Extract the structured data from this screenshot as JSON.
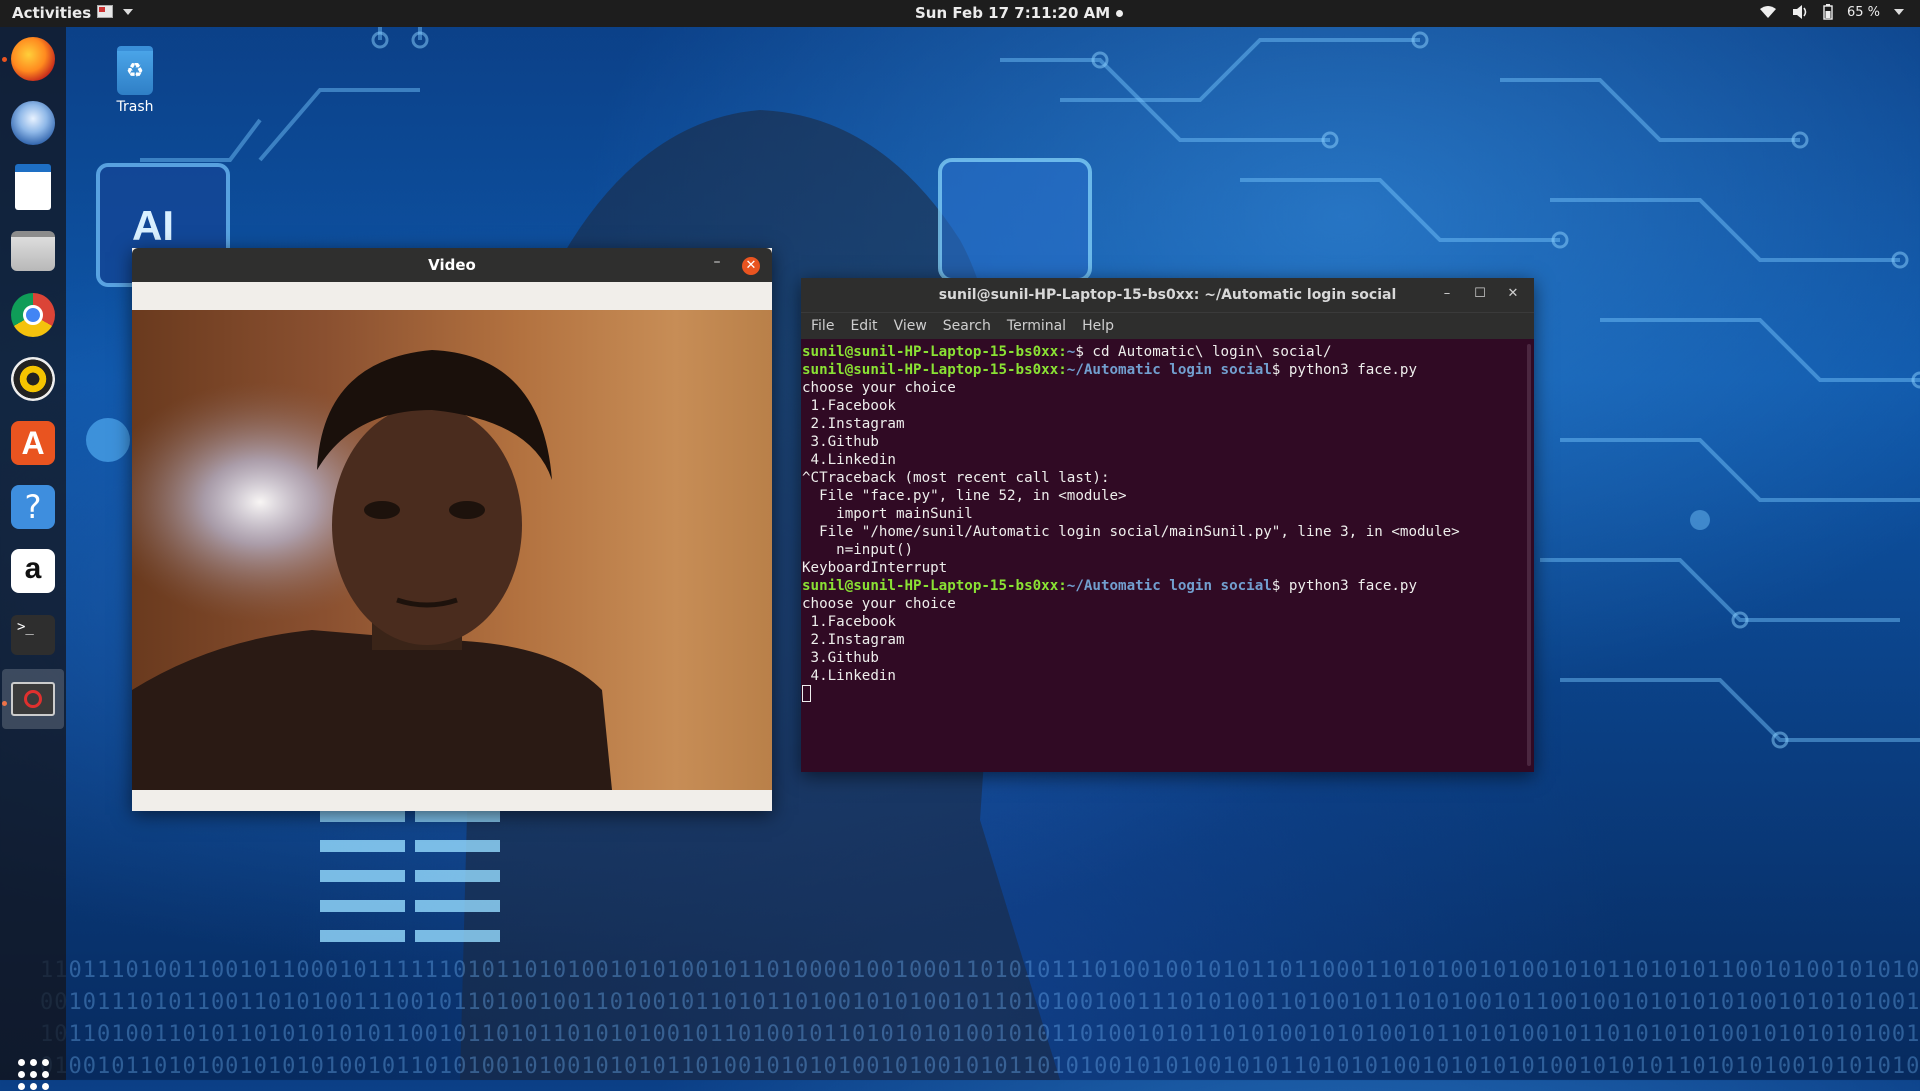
{
  "topbar": {
    "activities": "Activities",
    "clock": "Sun Feb 17   7:11:20 AM",
    "battery": "65 %",
    "icons": [
      "keyboard-flag-icon",
      "wifi-icon",
      "volume-icon",
      "battery-icon",
      "system-menu-chevron-icon"
    ]
  },
  "desktop": {
    "trash_label": "Trash"
  },
  "dock": {
    "items": [
      "Firefox",
      "Thunderbird",
      "LibreOffice Writer",
      "Files",
      "Chrome",
      "Rhythmbox",
      "Ubuntu Software",
      "Help",
      "Amazon",
      "Terminal",
      "Video"
    ]
  },
  "video_window": {
    "title": "Video",
    "minimize": "–",
    "close": "✕"
  },
  "terminal_window": {
    "title": "sunil@sunil-HP-Laptop-15-bs0xx: ~/Automatic login social",
    "menu": [
      "File",
      "Edit",
      "View",
      "Search",
      "Terminal",
      "Help"
    ],
    "lines": [
      {
        "user": "sunil@sunil-HP-Laptop-15-bs0xx",
        "path": "~",
        "cmd": "$ cd Automatic\\ login\\ social/"
      },
      {
        "user": "sunil@sunil-HP-Laptop-15-bs0xx",
        "path": "~/Automatic login social",
        "cmd": "$ python3 face.py"
      },
      {
        "text": "choose your choice"
      },
      {
        "text": " 1.Facebook"
      },
      {
        "text": " 2.Instagram"
      },
      {
        "text": " 3.Github"
      },
      {
        "text": " 4.Linkedin"
      },
      {
        "text": "^CTraceback (most recent call last):"
      },
      {
        "text": "  File \"face.py\", line 52, in <module>"
      },
      {
        "text": "    import mainSunil"
      },
      {
        "text": "  File \"/home/sunil/Automatic login social/mainSunil.py\", line 3, in <module>"
      },
      {
        "text": "    n=input()"
      },
      {
        "text": "KeyboardInterrupt"
      },
      {
        "user": "sunil@sunil-HP-Laptop-15-bs0xx",
        "path": "~/Automatic login social",
        "cmd": "$ python3 face.py"
      },
      {
        "text": "choose your choice"
      },
      {
        "text": " 1.Facebook"
      },
      {
        "text": " 2.Instagram"
      },
      {
        "text": " 3.Github"
      },
      {
        "text": " 4.Linkedin"
      }
    ]
  },
  "colors": {
    "accent": "#e95420",
    "terminal_bg": "#300a24",
    "prompt_user": "#8ae234",
    "prompt_path": "#729fcf"
  }
}
